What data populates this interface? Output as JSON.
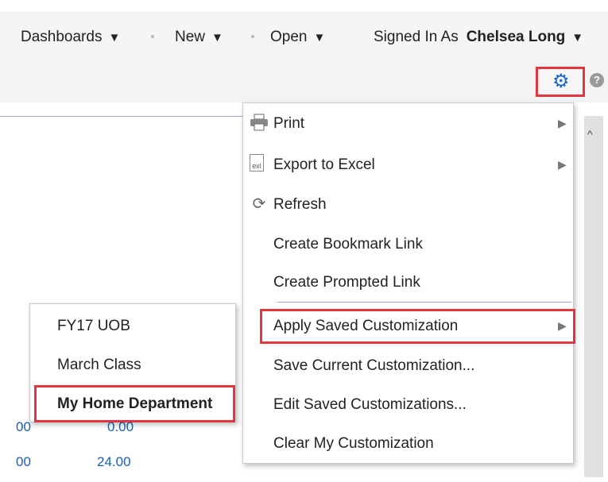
{
  "header": {
    "nav": [
      {
        "label": "Dashboards",
        "caret": "▼"
      },
      {
        "label": "New",
        "caret": "▼"
      },
      {
        "label": "Open",
        "caret": "▼"
      }
    ],
    "signed_in_label": "Signed In As",
    "user_name": "Chelsea Long",
    "user_caret": "▼",
    "gear_icon": "gear-icon",
    "gear_color": "#1a66c9",
    "help_glyph": "?"
  },
  "background_rows": [
    {
      "col1": "00",
      "col2": "0.00"
    },
    {
      "col1": "00",
      "col2": "24.00"
    }
  ],
  "menu": {
    "items": [
      {
        "label": "Print",
        "icon": "printer-icon",
        "has_submenu": true
      },
      {
        "label": "Export to Excel",
        "icon": "excel-icon",
        "has_submenu": true
      },
      {
        "label": "Refresh",
        "icon": "refresh-icon",
        "has_submenu": false
      },
      {
        "label": "Create Bookmark Link",
        "icon": "",
        "has_submenu": false
      },
      {
        "label": "Create Prompted Link",
        "icon": "",
        "has_submenu": false
      },
      {
        "label": "Apply Saved Customization",
        "icon": "",
        "has_submenu": true
      },
      {
        "label": "Save Current Customization...",
        "icon": "",
        "has_submenu": false
      },
      {
        "label": "Edit Saved Customizations...",
        "icon": "",
        "has_submenu": false
      },
      {
        "label": "Clear My Customization",
        "icon": "",
        "has_submenu": false
      }
    ],
    "submenu_arrow": "▶",
    "excel_icon_text": "exl"
  },
  "submenu": {
    "items": [
      {
        "label": "FY17 UOB"
      },
      {
        "label": "March Class"
      },
      {
        "label": "My Home Department"
      }
    ]
  },
  "highlight_color": "#e0363e"
}
